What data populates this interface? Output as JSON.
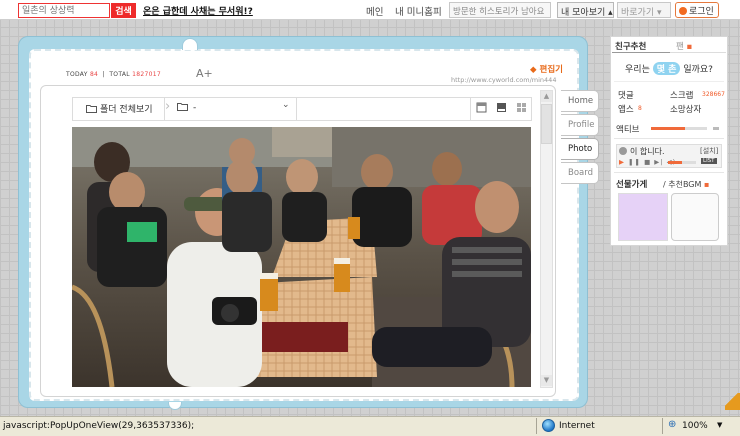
{
  "topbar": {
    "search_placeholder": "일촌의 상상력",
    "search_button": "검색",
    "promo_link": "온은 급한데 사채는 무서워!?",
    "nav_main": "메인",
    "nav_mini": "내 미니홈피",
    "nav_visit_history": "방문한 히스토리가 남아요",
    "nav_box_1": "내 모아보기",
    "nav_box_2": "바로가기",
    "login": "로그인"
  },
  "frame": {
    "today_label": "TODAY",
    "today_value": "84",
    "total_label": "TOTAL",
    "total_value": "1827017",
    "font_size_glyph": "A+",
    "edit_link": "편집기",
    "url": "http://www.cyworld.com/min444"
  },
  "toolbar": {
    "view_all_folders": "폴더 전체보기",
    "folder_select": "-"
  },
  "tabs": [
    {
      "label": "Home"
    },
    {
      "label": "Profile"
    },
    {
      "label": "Photo"
    },
    {
      "label": "Board"
    }
  ],
  "right_panel": {
    "tab_active": "친구추천",
    "tab_other": "팬",
    "question_pre": "우리는",
    "question_highlight": "몇 촌",
    "question_post": "일까요?",
    "items": [
      {
        "label": "댓글",
        "value": ""
      },
      {
        "label": "스크랩",
        "value": "328667"
      },
      {
        "label": "앱스",
        "value": "8"
      },
      {
        "label": "소망상자",
        "value": ""
      }
    ],
    "activity_label": "액티브",
    "activity_level": 0.6,
    "player_text": "이 합니다.",
    "player_install": "[설치]",
    "player_list": "LIST",
    "shop_title": "선물가게",
    "shop_sub": "/ 추천BGM"
  },
  "statusbar": {
    "text": "javascript:PopUpOneView(29,363537336);",
    "zone": "Internet",
    "zoom": "100%"
  },
  "colors": {
    "frame_blue": "#a9d6e6",
    "accent_orange": "#f06a3a",
    "search_red": "#ee2b2b",
    "highlight_blue": "#8fd3f0"
  }
}
